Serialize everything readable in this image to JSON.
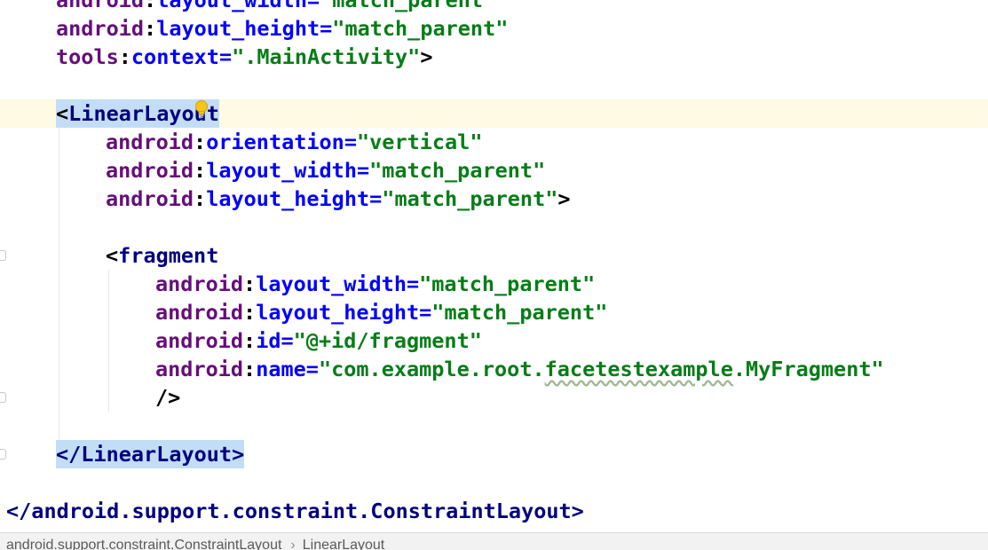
{
  "editor": {
    "lines": [
      {
        "ns": "android",
        "attr": "layout_width",
        "value": "\"match_parent\""
      },
      {
        "ns": "android",
        "attr": "layout_height",
        "value": "\"match_parent\""
      },
      {
        "ns": "tools",
        "attr": "context",
        "value": "\".MainActivity\"",
        "close": ">"
      },
      {
        "tag_open": "<",
        "tag": "LinearLayout"
      },
      {
        "ns": "android",
        "attr": "orientation",
        "value": "\"vertical\""
      },
      {
        "ns": "android",
        "attr": "layout_width",
        "value": "\"match_parent\""
      },
      {
        "ns": "android",
        "attr": "layout_height",
        "value": "\"match_parent\"",
        "close": ">"
      },
      {
        "tag_open": "<",
        "tag": "fragment"
      },
      {
        "ns": "android",
        "attr": "layout_width",
        "value": "\"match_parent\""
      },
      {
        "ns": "android",
        "attr": "layout_height",
        "value": "\"match_parent\""
      },
      {
        "ns": "android",
        "attr": "id",
        "value": "\"@+id/fragment\""
      },
      {
        "ns": "android",
        "attr": "name",
        "value_pre": "\"com.example.root.",
        "value_warn": "facetestexample",
        "value_post": ".MyFragment\""
      },
      {
        "text": "/>"
      },
      {
        "text": "</LinearLayout>"
      },
      {
        "text": "</android.support.constraint.ConstraintLayout>"
      }
    ]
  },
  "breadcrumb": {
    "items": [
      "android.support.constraint.ConstraintLayout",
      "LinearLayout"
    ],
    "separator": "›"
  },
  "colors": {
    "namespace": "#660e7a",
    "attribute": "#0000ff",
    "string": "#067d17",
    "tag": "#000080",
    "current_line": "#fffae3",
    "tag_highlight": "#c3ddf6"
  },
  "icons": [
    "lightbulb-icon",
    "fold-marker-icon"
  ]
}
